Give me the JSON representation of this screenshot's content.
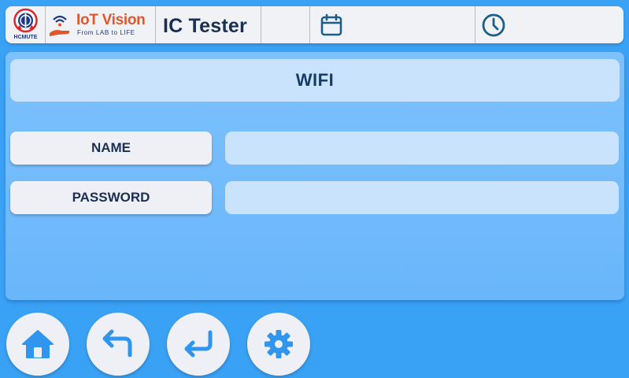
{
  "header": {
    "hcmute_logo_text": "HCMUTE",
    "brand_name": "IoT Vision",
    "brand_tagline": "From LAB to LIFE",
    "app_title": "IC Tester",
    "date_icon": "calendar-icon",
    "time_icon": "clock-icon"
  },
  "panel": {
    "title": "WIFI",
    "fields": {
      "name_label": "NAME",
      "name_value": "",
      "password_label": "PASSWORD",
      "password_value": ""
    }
  },
  "nav": {
    "buttons": [
      {
        "name": "home",
        "icon": "home-icon"
      },
      {
        "name": "back",
        "icon": "back-arrow-icon"
      },
      {
        "name": "enter",
        "icon": "enter-return-icon"
      },
      {
        "name": "settings",
        "icon": "gear-icon"
      }
    ]
  },
  "colors": {
    "background": "#3aa2f5",
    "panel": "#6ab6fb",
    "title_bar": "#c9e3fd",
    "label_bg": "#eff0f5",
    "icon_blue": "#2f95ee",
    "header_icon": "#1a5e8a",
    "brand_orange": "#e1572c",
    "text_dark": "#1a2f52"
  }
}
